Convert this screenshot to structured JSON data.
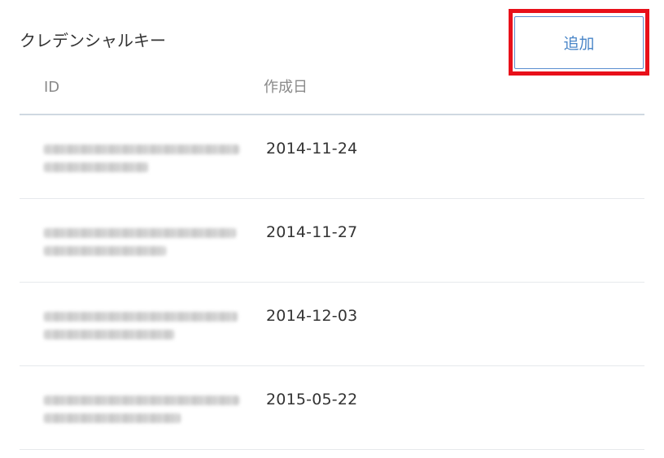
{
  "section": {
    "title": "クレデンシャルキー",
    "add_button_label": "追加"
  },
  "table": {
    "headers": {
      "id": "ID",
      "created": "作成日"
    },
    "rows": [
      {
        "id": "",
        "created": "2014-11-24"
      },
      {
        "id": "",
        "created": "2014-11-27"
      },
      {
        "id": "",
        "created": "2014-12-03"
      },
      {
        "id": "",
        "created": "2015-05-22"
      }
    ]
  },
  "colors": {
    "accent": "#4a86c8",
    "highlight": "#e8101a",
    "divider": "#cfd8e1"
  }
}
